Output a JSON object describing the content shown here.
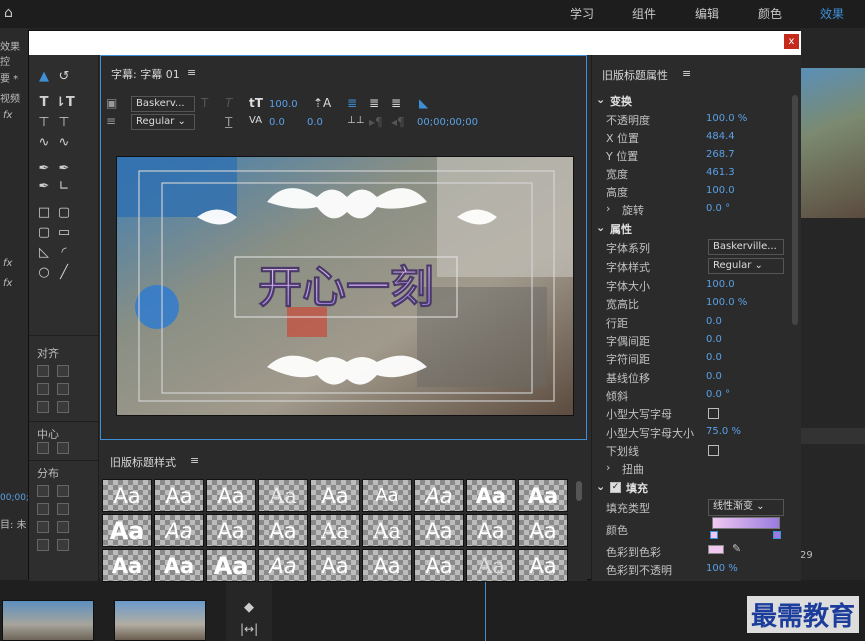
{
  "topbar": {
    "workspaces": [
      "学习",
      "组件",
      "编辑",
      "颜色",
      "效果"
    ],
    "active": "效果"
  },
  "background": {
    "left_labels": [
      "效果控",
      "要 *",
      "视频",
      "fx",
      "fx",
      "fx",
      "对齐",
      "中心",
      "分布",
      "00;00;",
      "目: 未"
    ],
    "right_values": [
      "29"
    ]
  },
  "dialog": {
    "close_label": "x"
  },
  "tools": {
    "align_label": "对齐",
    "center_label": "中心",
    "distribute_label": "分布"
  },
  "title_panel": {
    "title": "字幕: 字幕 01",
    "menu_icon": "≡",
    "font_family": "Baskerv...",
    "font_style": "Regular",
    "font_size": "100.0",
    "kerning": "0.0",
    "tracking_offset": "0.0",
    "timecode": "00;00;00;00",
    "caption_text": "开心一刻"
  },
  "styles_panel": {
    "title": "旧版标题样式",
    "menu_icon": "≡",
    "sample": "Aa"
  },
  "props": {
    "title": "旧版标题属性",
    "menu_icon": "≡",
    "transform": {
      "header": "变换",
      "opacity_label": "不透明度",
      "opacity": "100.0 %",
      "x_label": "X 位置",
      "x": "484.4",
      "y_label": "Y 位置",
      "y": "268.7",
      "width_label": "宽度",
      "width": "461.3",
      "height_label": "高度",
      "height": "100.0",
      "rotation_label": "旋转",
      "rotation": "0.0 °"
    },
    "properties": {
      "header": "属性",
      "family_label": "字体系列",
      "family": "Baskerville...",
      "style_label": "字体样式",
      "style": "Regular",
      "size_label": "字体大小",
      "size": "100.0",
      "aspect_label": "宽高比",
      "aspect": "100.0 %",
      "leading_label": "行距",
      "leading": "0.0",
      "kerning_label": "字偶间距",
      "kerning": "0.0",
      "tracking_label": "字符间距",
      "tracking": "0.0",
      "baseline_label": "基线位移",
      "baseline": "0.0",
      "slant_label": "倾斜",
      "slant": "0.0 °",
      "smallcaps_label": "小型大写字母",
      "smallcaps_size_label": "小型大写字母大小",
      "smallcaps_size": "75.0 %",
      "underline_label": "下划线",
      "distort_label": "扭曲"
    },
    "fill": {
      "header": "填充",
      "type_label": "填充类型",
      "type": "线性渐变",
      "color_label": "颜色",
      "color_to_color_label": "色彩到色彩",
      "color_to_opacity_label": "色彩到不透明",
      "color_to_opacity": "100 %",
      "grad_start": "#f0c8f0",
      "grad_end": "#9a7be0"
    }
  },
  "watermark": "最需教育"
}
